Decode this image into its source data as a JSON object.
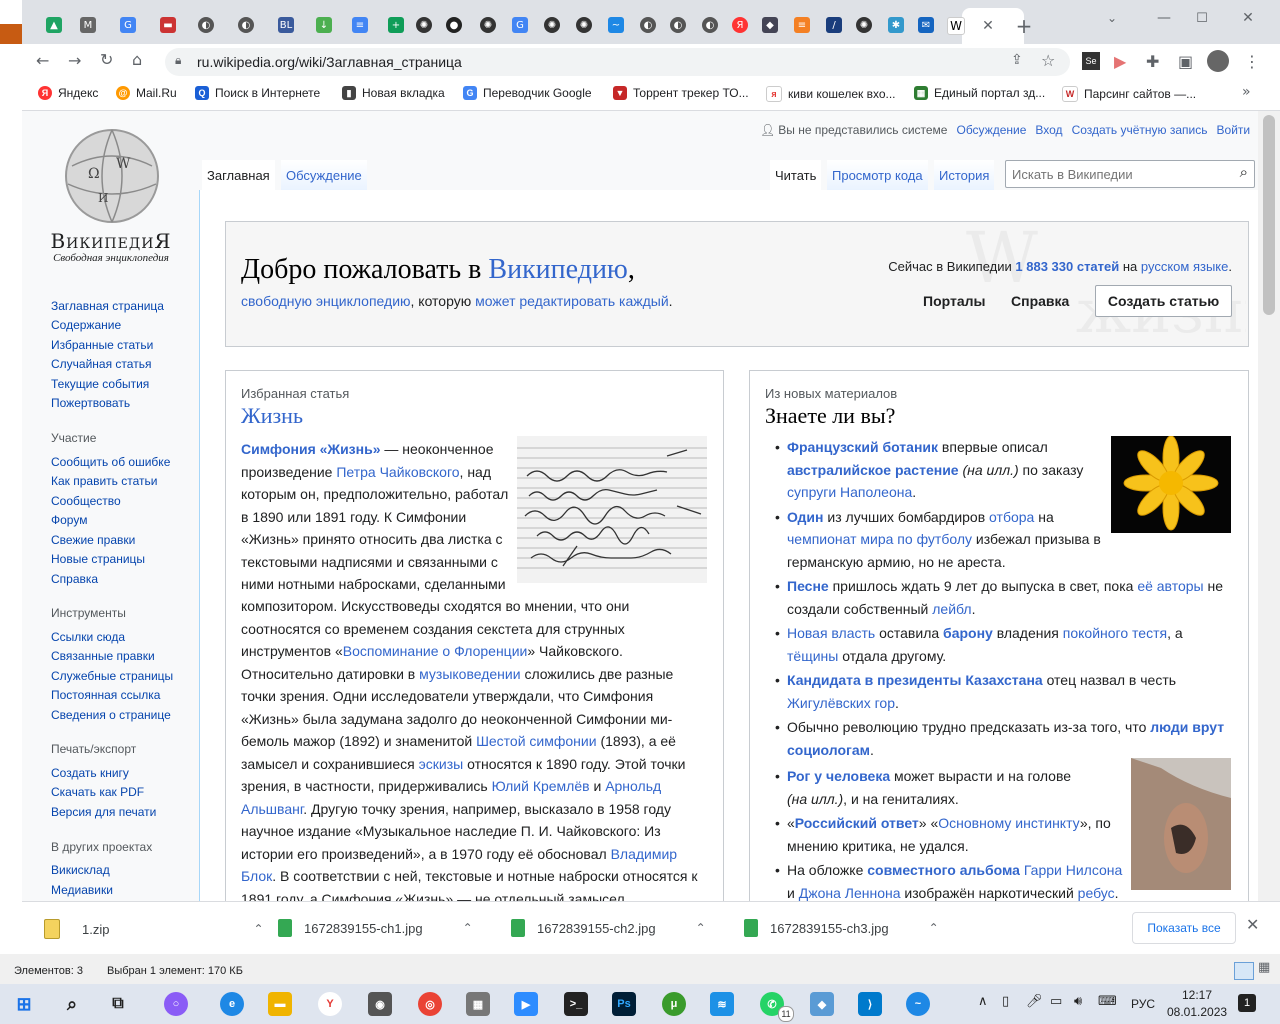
{
  "browser": {
    "url": "ru.wikipedia.org/wiki/Заглавная_страница",
    "tab_letter": "W",
    "new_tab": "+",
    "bookmarks": [
      "Яндекс",
      "Mail.Ru",
      "Поиск в Интернете",
      "Новая вкладка",
      "Переводчик Google",
      "Торрент трекер ТО...",
      "киви кошелек вхо...",
      "Единый портал зд...",
      "Парсинг сайтов —..."
    ]
  },
  "wiki": {
    "logo_title": "ВикипедиЯ",
    "logo_subtitle": "Свободная энциклопедия",
    "personal": {
      "not_logged": "Вы не представились системе",
      "talk": "Обсуждение",
      "login": "Вход",
      "create_account": "Создать учётную запись",
      "logout": "Войти"
    },
    "tabs": {
      "main": "Заглавная",
      "discussion": "Обсуждение",
      "read": "Читать",
      "view_source": "Просмотр кода",
      "history": "История"
    },
    "search_placeholder": "Искать в Википедии",
    "nav": [
      "Заглавная страница",
      "Содержание",
      "Избранные статьи",
      "Случайная статья",
      "Текущие события",
      "Пожертвовать"
    ],
    "participation_head": "Участие",
    "participation": [
      "Сообщить об ошибке",
      "Как править статьи",
      "Сообщество",
      "Форум",
      "Свежие правки",
      "Новые страницы",
      "Справка"
    ],
    "tools_head": "Инструменты",
    "tools": [
      "Ссылки сюда",
      "Связанные правки",
      "Служебные страницы",
      "Постоянная ссылка",
      "Сведения о странице"
    ],
    "print_head": "Печать/экспорт",
    "print": [
      "Создать книгу",
      "Скачать как PDF",
      "Версия для печати"
    ],
    "other_head": "В других проектах",
    "other": [
      "Викисклад",
      "Медиавики"
    ],
    "banner": {
      "welcome_a": "Добро пожаловать в ",
      "welcome_link": "Википедию",
      "welcome_c": ",",
      "sub_link1": "свободную энциклопедию",
      "sub_mid": ", которую ",
      "sub_link2": "может редактировать каждый",
      "sub_end": ".",
      "now_a": "Сейчас в Википедии ",
      "count": "1 883 330 статей",
      "now_b": " на ",
      "lang": "русском языке",
      "now_c": ".",
      "portals": "Порталы",
      "help": "Справка",
      "create": "Создать статью"
    },
    "featured": {
      "kicker": "Избранная статья",
      "title": "Жизнь"
    },
    "dyk": {
      "kicker": "Из новых материалов",
      "title": "Знаете ли вы?"
    }
  },
  "downloads": [
    "1.zip",
    "1672839155-ch1.jpg",
    "1672839155-ch2.jpg",
    "1672839155-ch3.jpg"
  ],
  "downloads_show_all": "Показать все",
  "explorer_status": {
    "items": "Элементов: 3",
    "selected": "Выбран 1 элемент: 170 КБ"
  },
  "taskbar": {
    "lang": "РУС",
    "time": "12:17",
    "date": "08.01.2023",
    "notifications": "1"
  }
}
